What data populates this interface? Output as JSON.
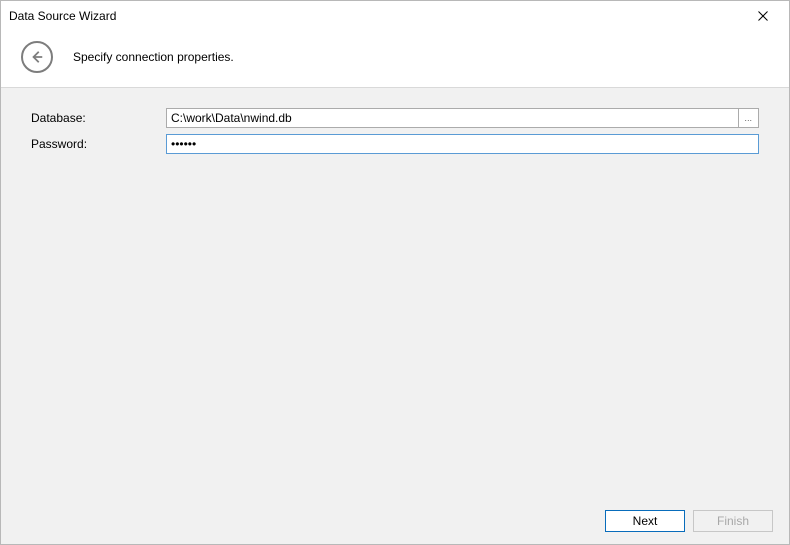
{
  "titlebar": {
    "title": "Data Source Wizard"
  },
  "header": {
    "instruction": "Specify connection properties."
  },
  "form": {
    "database": {
      "label": "Database:",
      "value": "C:\\work\\Data\\nwind.db",
      "browse_ellipsis": "…"
    },
    "password": {
      "label": "Password:",
      "value": "••••••"
    }
  },
  "footer": {
    "next_label": "Next",
    "finish_label": "Finish"
  }
}
